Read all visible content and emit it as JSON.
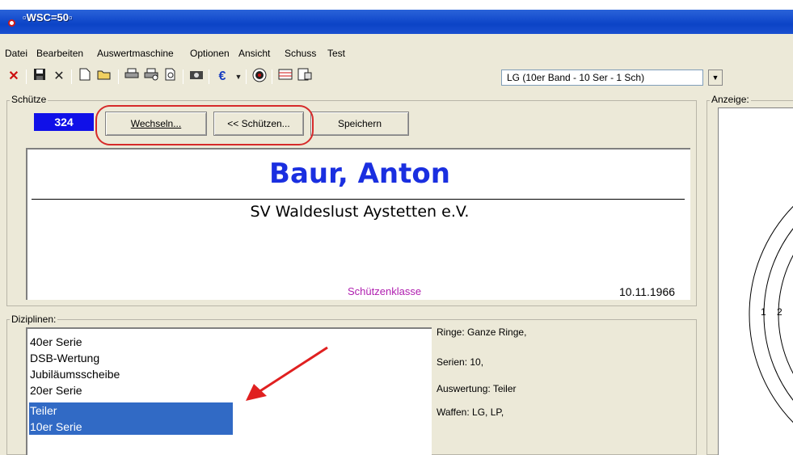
{
  "window": {
    "title": "▫WSC=50▫"
  },
  "menu": [
    "Datei",
    "Bearbeiten",
    "Auswertmaschine",
    "Optionen",
    "Ansicht",
    "Schuss",
    "Test"
  ],
  "toolbar": {
    "icons": [
      "close-red-x-icon",
      "save-icon",
      "delete-x-icon",
      "new-icon",
      "open-folder-icon",
      "print-icon",
      "print-setup-icon",
      "print-preview-icon",
      "camera-icon",
      "euro-icon",
      "dropdown-arrow-icon",
      "target-icon",
      "list-icon",
      "properties-icon"
    ],
    "euro_symbol": "€",
    "discipline_select": "LG (10er Band - 10 Ser - 1 Sch)"
  },
  "shooter_group": {
    "label": "Schütze",
    "id": "324",
    "buttons": {
      "change": "Wechseln...",
      "shooters": "<< Schützen...",
      "save": "Speichern"
    },
    "name": "Baur, Anton",
    "club": "SV Waldeslust Aystetten e.V.",
    "class": "Schützenklasse",
    "birthdate": "10.11.1966"
  },
  "disciplines_group": {
    "label": "Diziplinen:",
    "items": [
      {
        "label": "40er Serie",
        "selected": false
      },
      {
        "label": "DSB-Wertung",
        "selected": false
      },
      {
        "label": "Jubiläumsscheibe",
        "selected": false
      },
      {
        "label": "20er Serie",
        "selected": false
      },
      {
        "label": "Teiler",
        "selected": true
      },
      {
        "label": "10er Serie",
        "selected": true
      }
    ],
    "details": {
      "rings": "Ringe: Ganze Ringe,",
      "series": "Serien: 10,",
      "evaluation": "Auswertung: Teiler",
      "weapons": "Waffen: LG, LP,"
    }
  },
  "anzeige_group": {
    "label": "Anzeige:",
    "ring_labels": [
      "1",
      "2"
    ]
  },
  "colors": {
    "selection": "#316ac5",
    "id_box": "#1010e8",
    "name": "#1a2fe0",
    "class": "#b020b0",
    "annotation": "#d62a2a"
  }
}
